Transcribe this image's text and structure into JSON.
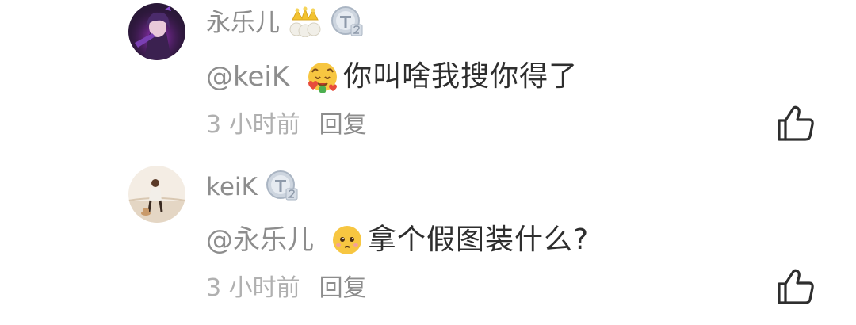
{
  "comments": [
    {
      "username": "永乐儿",
      "badges": [
        "crown-badge",
        "level-badge-t2"
      ],
      "mention": "@keiK",
      "emoji": "smiling-face-with-hearts-emoji",
      "text": "你叫啥我搜你得了",
      "time": "3 小时前",
      "reply_label": "回复",
      "like_icon": "thumbs-up-icon"
    },
    {
      "username": "keiK",
      "badges": [
        "level-badge-t2"
      ],
      "mention": "@永乐儿",
      "emoji": "pleading-face-emoji",
      "text": "拿个假图装什么?",
      "time": "3 小时前",
      "reply_label": "回复",
      "like_icon": "thumbs-up-icon"
    }
  ],
  "colors": {
    "username": "#8d8d8d",
    "text": "#2e2e2e",
    "time": "#b0b0b0",
    "badge_silver": "#b9c3cf",
    "crown_gold": "#f2c230"
  }
}
